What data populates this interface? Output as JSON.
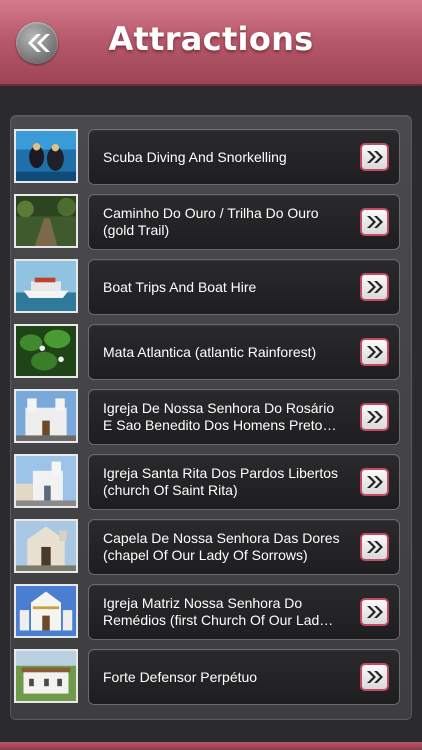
{
  "header": {
    "title": "Attractions",
    "back_icon": "double-chevron-left-icon",
    "color_top": "#d27b8c",
    "color_bottom": "#9d4456"
  },
  "items": [
    {
      "label": "Scuba Diving And Snorkelling",
      "thumb": "divers-photo"
    },
    {
      "label": "Caminho Do Ouro / Trilha Do Ouro (gold Trail)",
      "thumb": "forest-trail-photo"
    },
    {
      "label": "Boat Trips And Boat Hire",
      "thumb": "boat-photo"
    },
    {
      "label": "Mata Atlantica (atlantic Rainforest)",
      "thumb": "rainforest-leaves-photo"
    },
    {
      "label": "Igreja De Nossa Senhora Do Rosário E Sao Benedito Dos Homens Preto…",
      "thumb": "church-rosario-photo"
    },
    {
      "label": "Igreja Santa Rita Dos Pardos Libertos (church Of Saint Rita)",
      "thumb": "church-santa-rita-photo"
    },
    {
      "label": "Capela De Nossa Senhora Das Dores (chapel Of Our Lady Of Sorrows)",
      "thumb": "chapel-dores-photo"
    },
    {
      "label": "Igreja Matriz Nossa Senhora Do Remédios (first Church Of Our Lad…",
      "thumb": "church-remedios-photo"
    },
    {
      "label": "Forte Defensor Perpétuo",
      "thumb": "fort-photo"
    }
  ],
  "row_button_icon": "double-chevron-right-icon",
  "accent_color": "#c24a63"
}
